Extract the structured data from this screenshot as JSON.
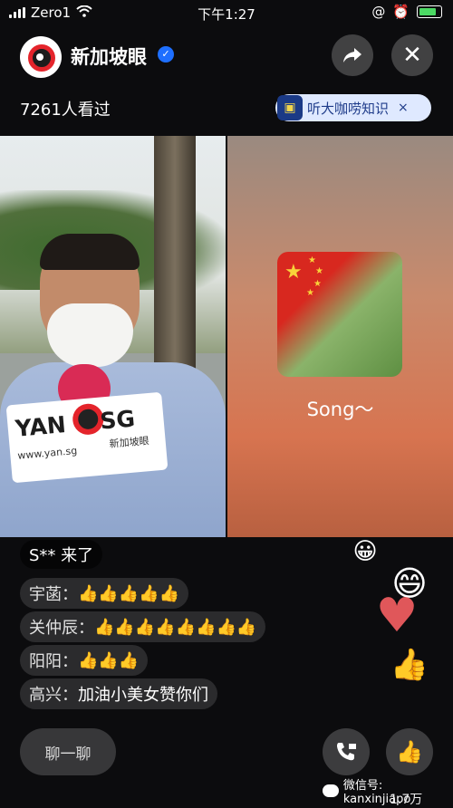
{
  "status": {
    "carrier": "Zero1",
    "time": "下午1:27"
  },
  "header": {
    "channel_name": "新加坡眼",
    "viewers": "7261人看过",
    "promo_label": "听大咖唠知识",
    "promo_close": "×"
  },
  "video": {
    "mic_brand": "YAN",
    "mic_brand2": "SG",
    "mic_url": "www.yan.sg",
    "mic_cn": "新加坡眼",
    "song_title": "Song～"
  },
  "comments": {
    "joined": "S** 来了",
    "items": [
      {
        "name": "宇菡：",
        "text": "👍👍👍👍👍"
      },
      {
        "name": "关仲辰：",
        "text": "👍👍👍👍👍👍👍👍"
      },
      {
        "name": "阳阳：",
        "text": "👍👍👍"
      },
      {
        "name": "高兴：",
        "text": "加油小美女赞你们"
      }
    ]
  },
  "bottom": {
    "chat_label": "聊一聊",
    "like_count": "1.7万",
    "watermark": "微信号: kanxinjiapo"
  },
  "icons": {
    "share": "share-icon",
    "close": "close-icon",
    "call": "call-icon",
    "like": "thumbs-up-icon"
  },
  "colors": {
    "brand_red": "#e4242b",
    "verify_blue": "#1e6fff",
    "battery_green": "#4cd964"
  }
}
